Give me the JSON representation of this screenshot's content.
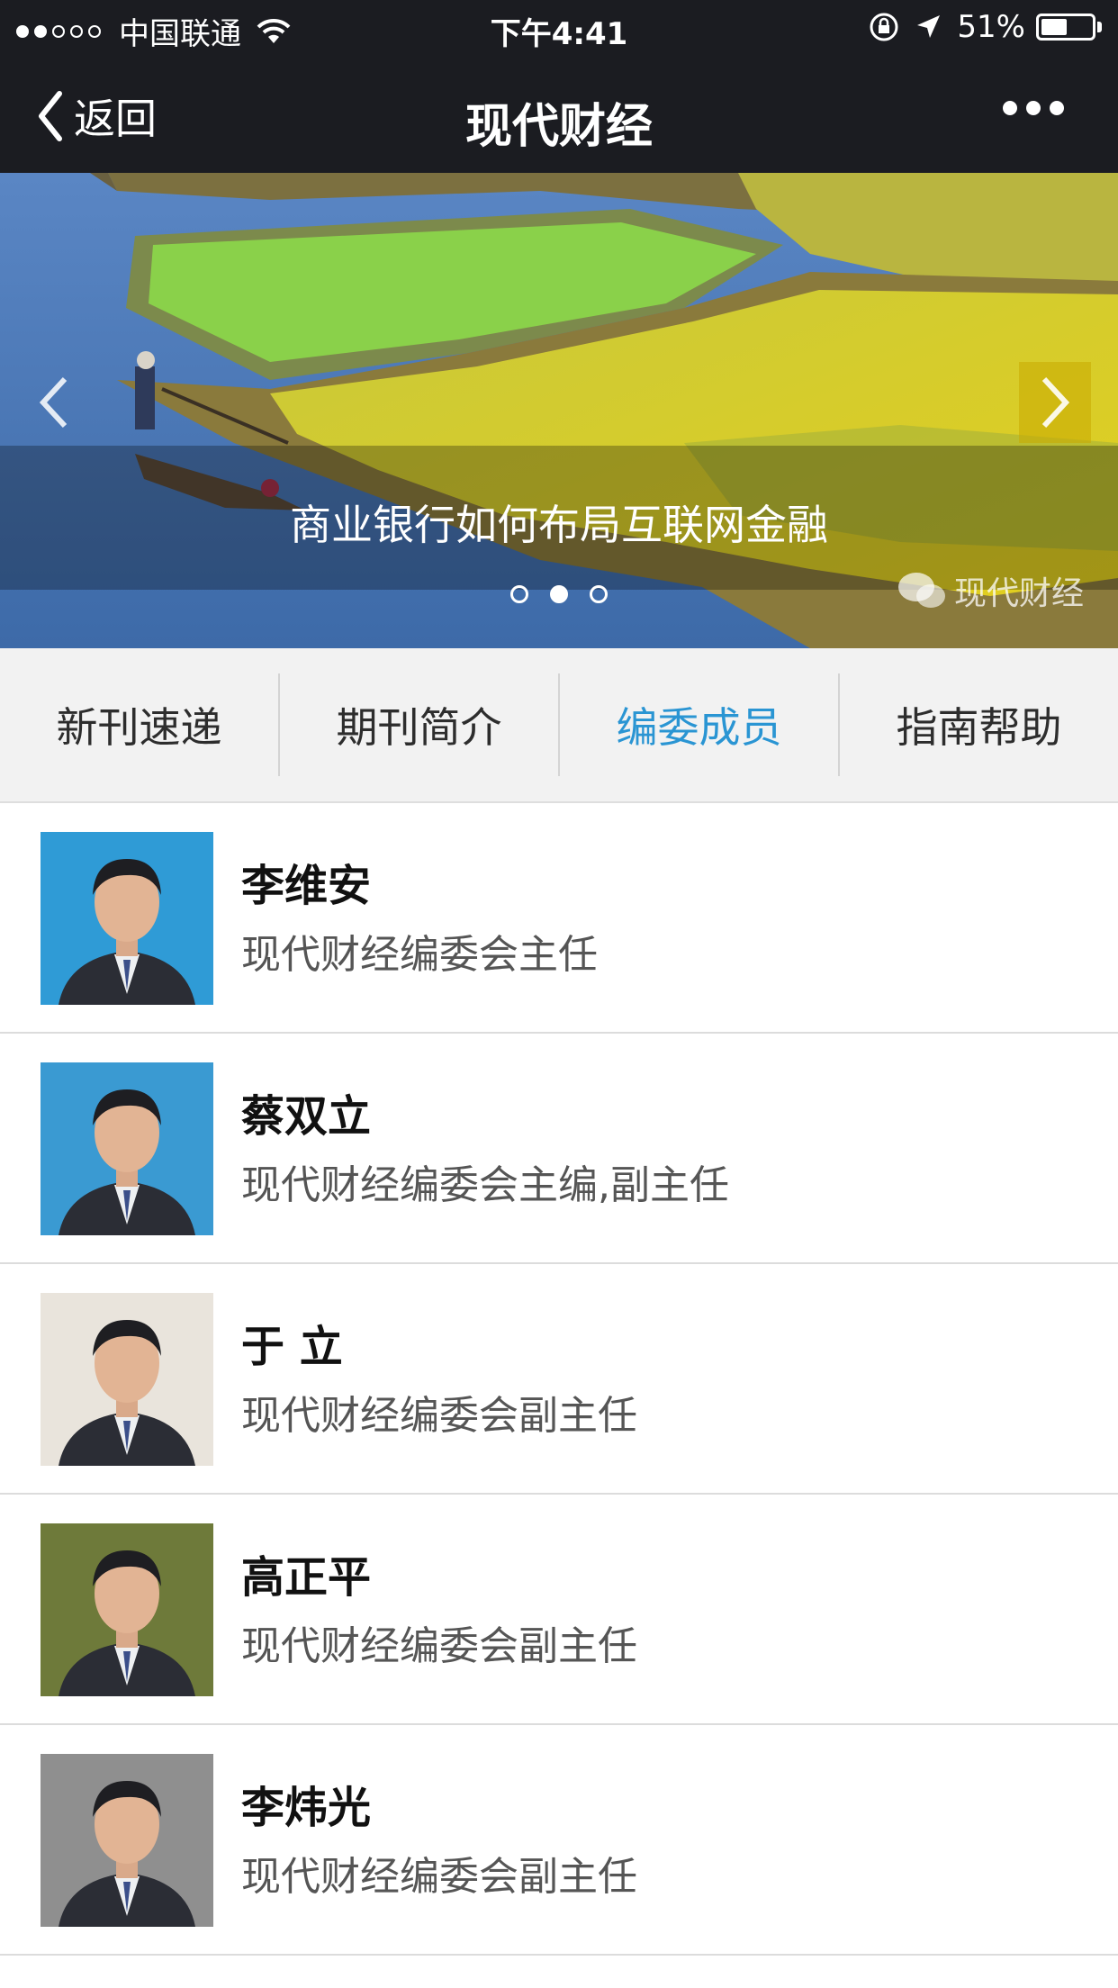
{
  "status_bar": {
    "carrier": "中国联通",
    "time": "下午4:41",
    "battery": "51%",
    "battery_level": 0.51,
    "signal_bars_filled": 2,
    "signal_bars_total": 5
  },
  "nav": {
    "back_label": "返回",
    "title": "现代财经"
  },
  "banner": {
    "caption": "商业银行如何布局互联网金融",
    "watermark": "现代财经",
    "page_count": 3,
    "active_page": 2
  },
  "tabs": [
    {
      "label": "新刊速递",
      "active": false
    },
    {
      "label": "期刊简介",
      "active": false
    },
    {
      "label": "编委成员",
      "active": true
    },
    {
      "label": "指南帮助",
      "active": false
    }
  ],
  "members": [
    {
      "name": "李维安",
      "title": "现代财经编委会主任",
      "bg": "#2f9bd6"
    },
    {
      "name": "蔡双立",
      "title": "现代财经编委会主编,副主任",
      "bg": "#3a9ad2"
    },
    {
      "name": "于 立",
      "title": "现代财经编委会副主任",
      "bg": "#e9e4dc"
    },
    {
      "name": "高正平",
      "title": "现代财经编委会副主任",
      "bg": "#6e7a3a"
    },
    {
      "name": "李炜光",
      "title": "现代财经编委会副主任",
      "bg": "#8f8f8f"
    }
  ],
  "colors": {
    "header_bg": "#1b1c21",
    "tab_active": "#2a95d3",
    "tab_bar_bg": "#f2f2f2"
  }
}
